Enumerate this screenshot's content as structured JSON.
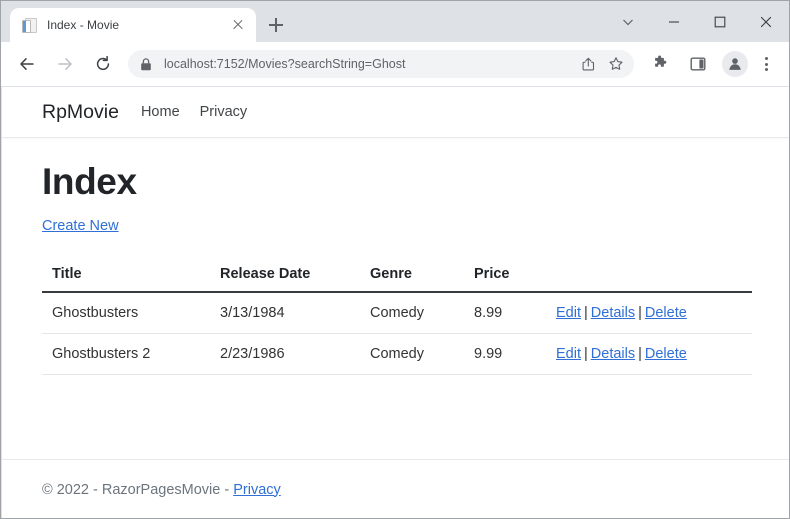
{
  "browser": {
    "tab": {
      "title": "Index - Movie",
      "favicon": "document-icon",
      "close_icon": "close-icon"
    },
    "new_tab_icon": "plus-icon",
    "window_controls": {
      "tab_search": "chevron-down-icon",
      "minimize": "minimize-icon",
      "maximize": "maximize-icon",
      "close": "close-icon"
    },
    "toolbar": {
      "back_icon": "arrow-left-icon",
      "forward_icon": "arrow-right-icon",
      "reload_icon": "reload-icon",
      "security_icon": "lock-icon",
      "url": "localhost:7152/Movies?searchString=Ghost",
      "url_placeholder": "Search Google or type a URL",
      "share_icon": "share-icon",
      "bookmark_icon": "star-icon",
      "extensions_icon": "puzzle-icon",
      "side_panel_icon": "side-panel-icon",
      "profile_icon": "account-avatar-icon",
      "menu_icon": "three-dot-menu-icon"
    }
  },
  "site": {
    "brand": "RpMovie",
    "nav": [
      {
        "label": "Home"
      },
      {
        "label": "Privacy"
      }
    ]
  },
  "main": {
    "heading": "Index",
    "create_link": "Create New",
    "table": {
      "columns": [
        "Title",
        "Release Date",
        "Genre",
        "Price",
        ""
      ],
      "rows": [
        {
          "title": "Ghostbusters",
          "release_date": "3/13/1984",
          "genre": "Comedy",
          "price": "8.99",
          "edit": "Edit",
          "details": "Details",
          "delete": "Delete"
        },
        {
          "title": "Ghostbusters 2",
          "release_date": "2/23/1986",
          "genre": "Comedy",
          "price": "9.99",
          "edit": "Edit",
          "details": "Details",
          "delete": "Delete"
        }
      ],
      "separator": "|"
    }
  },
  "footer": {
    "text": "© 2022 - RazorPagesMovie - ",
    "privacy_link": "Privacy"
  },
  "colors": {
    "link": "#2f6fd6",
    "tabstrip_bg": "#dee1e6",
    "omnibox_bg": "#f1f3f4",
    "text": "#212529",
    "muted": "#6c757d"
  }
}
